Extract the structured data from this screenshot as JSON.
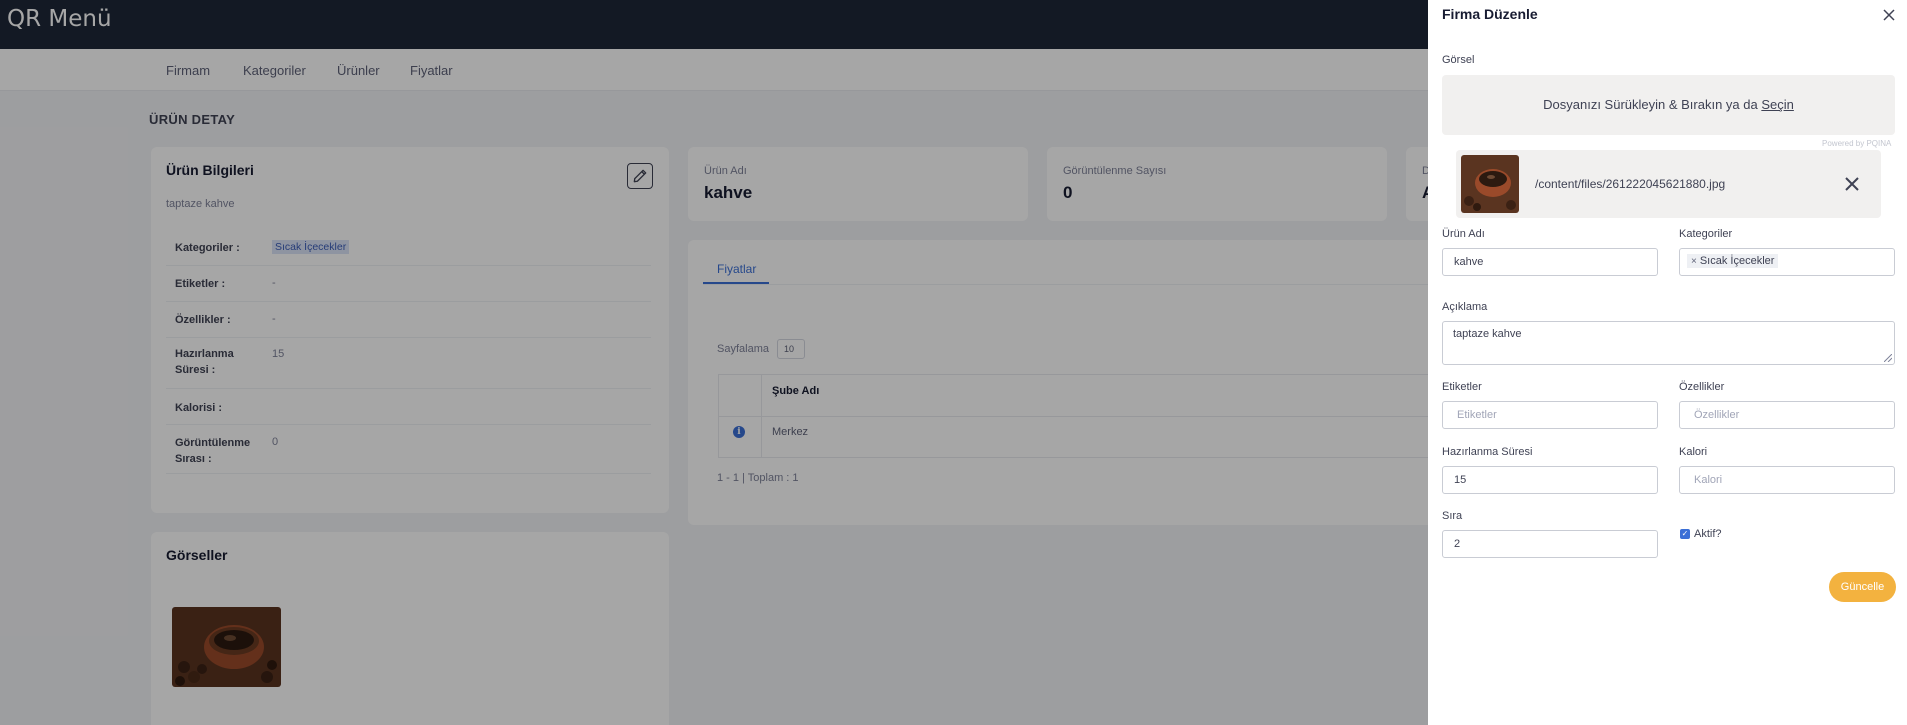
{
  "app": {
    "brand": "QR Menü"
  },
  "nav": {
    "items": [
      "Firmam",
      "Kategoriler",
      "Ürünler",
      "Fiyatlar"
    ]
  },
  "page": {
    "title": "ÜRÜN DETAY"
  },
  "product_info": {
    "title": "Ürün Bilgileri",
    "description": "taptaze kahve",
    "rows": [
      {
        "label": "Kategoriler :",
        "value": "Sıcak İçecekler"
      },
      {
        "label": "Etiketler :",
        "value": "-"
      },
      {
        "label": "Özellikler :",
        "value": "-"
      },
      {
        "label": "Hazırlanma Süresi :",
        "value": "15"
      },
      {
        "label": "Kalorisi :",
        "value": ""
      },
      {
        "label": "Görüntülenme Sırası :",
        "value": "0"
      }
    ]
  },
  "stats": [
    {
      "label": "Ürün Adı",
      "value": "kahve"
    },
    {
      "label": "Görüntülenme Sayısı",
      "value": "0"
    },
    {
      "label": "D",
      "value": "A"
    }
  ],
  "prices": {
    "tab": "Fiyatlar",
    "pagination_label": "Sayfalama",
    "page_size": "10",
    "table": {
      "header": "Şube Adı",
      "rows": [
        "Merkez"
      ]
    },
    "summary": "1 - 1 | Toplam : 1"
  },
  "images": {
    "title": "Görseller"
  },
  "panel": {
    "title": "Firma Düzenle",
    "image_label": "Görsel",
    "dropzone_text": "Dosyanızı Sürükleyin & Bırakın ya da ",
    "dropzone_link": "Seçin",
    "powered_by": "Powered by PQINA",
    "file_name": "/content/files/261222045621880.jpg",
    "fields": {
      "name": {
        "label": "Ürün Adı",
        "value": "kahve"
      },
      "categories": {
        "label": "Kategoriler",
        "chip": "Sıcak İçecekler"
      },
      "description": {
        "label": "Açıklama",
        "value": "taptaze kahve"
      },
      "tags": {
        "label": "Etiketler",
        "placeholder": "Etiketler"
      },
      "features": {
        "label": "Özellikler",
        "placeholder": "Özellikler"
      },
      "prep_time": {
        "label": "Hazırlanma Süresi",
        "value": "15"
      },
      "calorie": {
        "label": "Kalori",
        "placeholder": "Kalori"
      },
      "order": {
        "label": "Sıra",
        "value": "2"
      },
      "active": {
        "label": "Aktif?"
      }
    },
    "submit_label": "Güncelle"
  },
  "colors": {
    "topbar": "#1e2738",
    "accent": "#3b6fd6",
    "update_button": "#f3b23f"
  }
}
